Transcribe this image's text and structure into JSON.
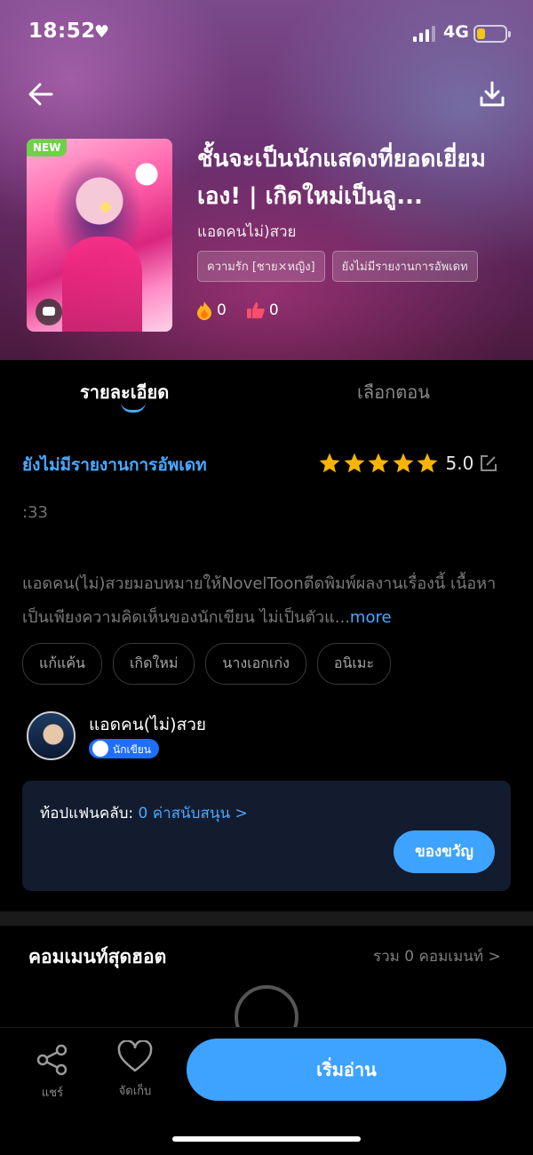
{
  "status_bar": {
    "time": "18:52",
    "network": "4G",
    "battery_level": 0.3
  },
  "book": {
    "badge": "NEW",
    "title": "ชั้นจะเป็นนักแสดงที่ยอดเยี่ยมเอง! | เกิดใหม่เป็นลู...",
    "author": "แอดคนไม่)สวย",
    "tags": [
      "ความรัก [ชาย×หญิง]",
      "ยังไม่มีรายงานการอัพเดท"
    ],
    "fire_count": "0",
    "like_count": "0"
  },
  "tabs": [
    {
      "label": "รายละเอียด",
      "active": true
    },
    {
      "label": "เลือกตอน",
      "active": false
    }
  ],
  "details": {
    "update_status": "ยังไม่มีรายงานการอัพเดท",
    "rating": "5.0",
    "rating_stars": 5,
    "chapter_count": ":33",
    "description": "แอดคน(ไม่)สวยมอบหมายให้NovelToonตีดพิมพ์ผลงานเรื่องนี้ เนื้อหาเป็นเพียงความคิดเห็นของนักเขียน ไม่เป็นตัวแ...",
    "more_label": "more",
    "genres": [
      "แก้แค้น",
      "เกิดใหม่",
      "นางเอกเก่ง",
      "อนิเมะ"
    ]
  },
  "author_section": {
    "name": "แอดคน(ไม่)สวย",
    "badge": "นักเขียน"
  },
  "fan_club": {
    "label": "ท้อปแฟนคลับ:",
    "value": "0 ค่าสนับสนุน >",
    "gift_button": "ของขวัญ"
  },
  "comments": {
    "title": "คอมเมนท์สุดฮอต",
    "total": "รวม 0 คอมเมนท์ >"
  },
  "bottom_bar": {
    "share_label": "แชร์",
    "favorite_label": "จัดเก็บ",
    "read_button": "เริ่มอ่าน"
  },
  "colors": {
    "accent": "#3ea3ff",
    "link": "#4aa8ff",
    "star": "#f7b500",
    "new_badge": "#6fd14a"
  }
}
